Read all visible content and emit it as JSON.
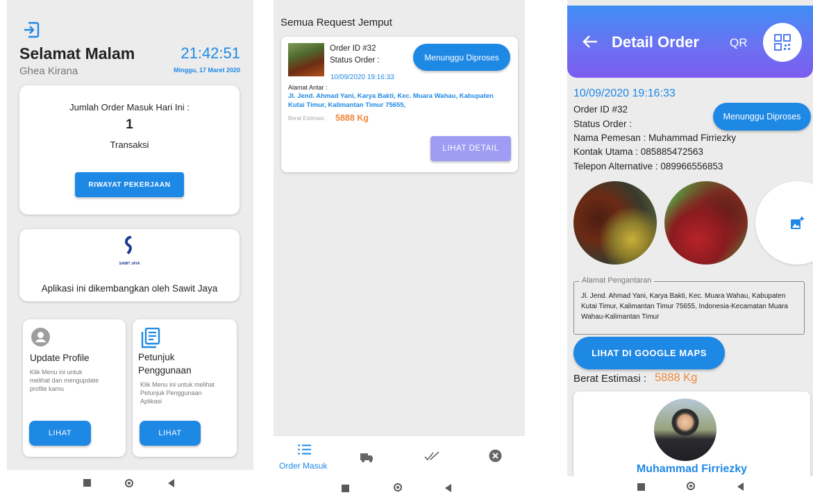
{
  "home": {
    "greeting": "Selamat Malam",
    "time": "21:42:51",
    "username": "Ghea Kirana",
    "date": "Minggu, 17 Maret 2020",
    "order_card": {
      "title": "Jumlah Order Masuk Hari Ini :",
      "count": "1",
      "unit": "Transaksi",
      "button": "RIWAYAT PEKERJAAN"
    },
    "brand_card": {
      "logo_text": "SAWIT JAYA",
      "tagline": "Aplikasi ini dikembangkan oleh Sawit Jaya"
    },
    "menu": [
      {
        "title": "Update Profile",
        "desc": "Klik Menu ini untuk melihat dan mengupdate profile kamu",
        "button": "LIHAT"
      },
      {
        "title": "Petunjuk Penggunaan",
        "desc": "Klik Menu ini untuk melihat Petunjuk Penggunaan Aplikasi",
        "button": "LIHAT"
      }
    ]
  },
  "requests": {
    "title": "Semua Request Jemput",
    "item": {
      "order_id": "Order ID #32",
      "status_label": "Status Order :",
      "status_badge": "Menunggu Diproses",
      "datetime": "10/09/2020 19:16:33",
      "address_label": "Alamat Antar :",
      "address": "Jl. Jend. Ahmad Yani, Karya Bakti, Kec. Muara Wahau, Kabupaten Kutai Timur, Kalimantan Timur 75655,",
      "weight_label": "Berat Estimasi :",
      "weight_value": "5888 Kg",
      "detail_button": "LIHAT DETAIL"
    },
    "bottom_nav": [
      {
        "label": "Order Masuk",
        "icon": "list-icon"
      },
      {
        "label": "",
        "icon": "truck-icon"
      },
      {
        "label": "",
        "icon": "double-check-icon"
      },
      {
        "label": "",
        "icon": "cancel-circle-icon"
      }
    ]
  },
  "detail": {
    "header_title": "Detail Order",
    "qr_label": "QR",
    "datetime": "10/09/2020 19:16:33",
    "order_id": "Order ID #32",
    "status_label": "Status Order :",
    "status_badge": "Menunggu Diproses",
    "customer": "Nama Pemesan : Muhammad Firriezky",
    "contact": "Kontak Utama : 085885472563",
    "phone_alt": "Telepon Alternative : 089966556853",
    "address_legend": "Alamat Pengantaran",
    "address": "Jl. Jend. Ahmad Yani, Karya Bakti, Kec. Muara Wahau, Kabupaten Kutai Timur, Kalimantan Timur 75655, Indonesia-Kecamatan Muara Wahau-Kalimantan Timur",
    "maps_button": "LIHAT DI GOOGLE MAPS",
    "weight_label": "Berat Estimasi :",
    "weight_value": "5888 Kg",
    "profile_name": "Muhammad Firriezky"
  },
  "colors": {
    "primary": "#1e88e5",
    "accent_orange": "#f0883e",
    "header_gradient_start": "#3f8ef5",
    "header_gradient_end": "#7c5cf0",
    "lilac_button": "#9e9cf3"
  }
}
